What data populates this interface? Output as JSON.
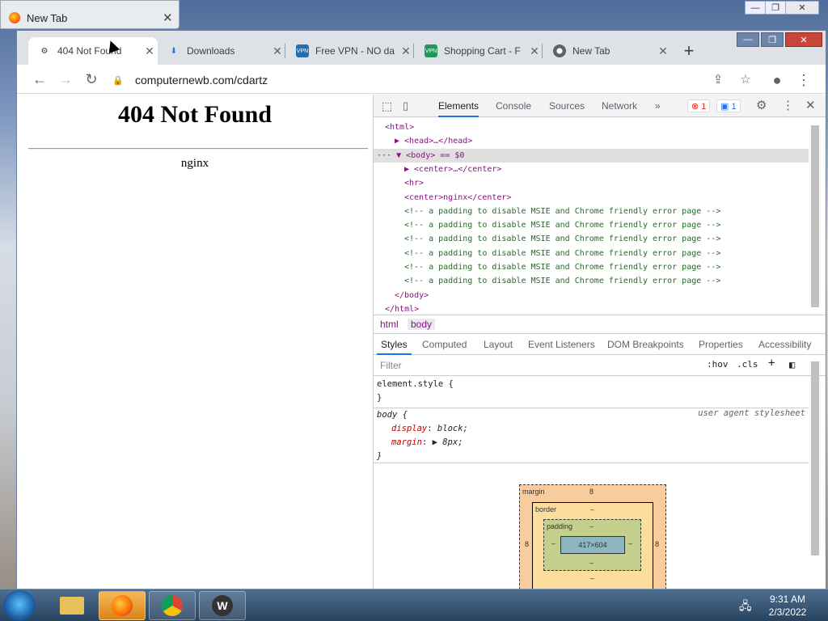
{
  "background_window": {
    "title": "New Tab",
    "close": "✕"
  },
  "outer_controls": {
    "minimize": "—",
    "restore": "❐",
    "close": "✕"
  },
  "browser": {
    "tabs": [
      {
        "label": "404 Not Found",
        "icon": "page-icon",
        "active": true
      },
      {
        "label": "Downloads",
        "icon": "download-icon",
        "active": false
      },
      {
        "label": "Free VPN - NO da",
        "icon": "vpn-icon",
        "active": false
      },
      {
        "label": "Shopping Cart - F",
        "icon": "vpn-icon",
        "active": false
      },
      {
        "label": "New Tab",
        "icon": "chrome-icon",
        "active": false
      }
    ],
    "tab_close": "✕",
    "new_tab": "+",
    "window_buttons": {
      "minimize": "—",
      "restore": "❐",
      "close": "✕"
    },
    "toolbar": {
      "back": "←",
      "forward": "→",
      "reload": "↻",
      "url": "computernewb.com/cdartz",
      "share": "⇪",
      "bookmark": "☆",
      "profile": "●",
      "menu": "⋮"
    }
  },
  "page": {
    "heading": "404 Not Found",
    "server": "nginx"
  },
  "devtools": {
    "tabs": [
      "Elements",
      "Console",
      "Sources",
      "Network",
      "»"
    ],
    "active_tab": "Elements",
    "error_count": "1",
    "message_count": "1",
    "dom_lines": [
      {
        "text": "<html>",
        "indent": 0,
        "kind": "tag"
      },
      {
        "text": "▶ <head>…</head>",
        "indent": 1,
        "kind": "tag"
      },
      {
        "text": "··· ▼ <body> == $0",
        "indent": 0,
        "kind": "tag",
        "selected": true
      },
      {
        "text": "▶ <center>…</center>",
        "indent": 2,
        "kind": "tag"
      },
      {
        "text": "<hr>",
        "indent": 3,
        "kind": "tag"
      },
      {
        "text": "<center>nginx</center>",
        "indent": 3,
        "kind": "tag"
      },
      {
        "text": "<!-- a padding to disable MSIE and Chrome friendly error page -->",
        "indent": 3,
        "kind": "comment"
      },
      {
        "text": "<!-- a padding to disable MSIE and Chrome friendly error page -->",
        "indent": 3,
        "kind": "comment"
      },
      {
        "text": "<!-- a padding to disable MSIE and Chrome friendly error page -->",
        "indent": 3,
        "kind": "comment"
      },
      {
        "text": "<!-- a padding to disable MSIE and Chrome friendly error page -->",
        "indent": 3,
        "kind": "comment"
      },
      {
        "text": "<!-- a padding to disable MSIE and Chrome friendly error page -->",
        "indent": 3,
        "kind": "comment"
      },
      {
        "text": "<!-- a padding to disable MSIE and Chrome friendly error page -->",
        "indent": 3,
        "kind": "comment"
      },
      {
        "text": "</body>",
        "indent": 1,
        "kind": "tag"
      },
      {
        "text": "</html>",
        "indent": 0,
        "kind": "tag"
      }
    ],
    "breadcrumbs": [
      "html",
      "body"
    ],
    "style_tabs": [
      "Styles",
      "Computed",
      "Layout",
      "Event Listeners",
      "DOM Breakpoints",
      "Properties",
      "Accessibility"
    ],
    "filter_placeholder": "Filter",
    "hov": ":hov",
    "cls": ".cls",
    "element_style": {
      "selector": "element.style {",
      "close": "}"
    },
    "body_rule": {
      "selector": "body {",
      "source": "user agent stylesheet",
      "props": [
        {
          "name": "display",
          "value": "block;"
        },
        {
          "name": "margin",
          "value": "▶ 8px;"
        }
      ],
      "close": "}"
    },
    "box_model": {
      "margin_label": "margin",
      "margin": "8",
      "border_label": "border",
      "border": "–",
      "padding_label": "padding",
      "padding": "–",
      "content": "417×604",
      "side_left": "8",
      "side_right": "8",
      "dash": "–"
    }
  },
  "taskbar": {
    "time": "9:31 AM",
    "date": "2/3/2022"
  },
  "colors": {
    "accent": "#1a73e8",
    "tag": "#881280",
    "comment": "#236e25",
    "error": "#d93025"
  }
}
